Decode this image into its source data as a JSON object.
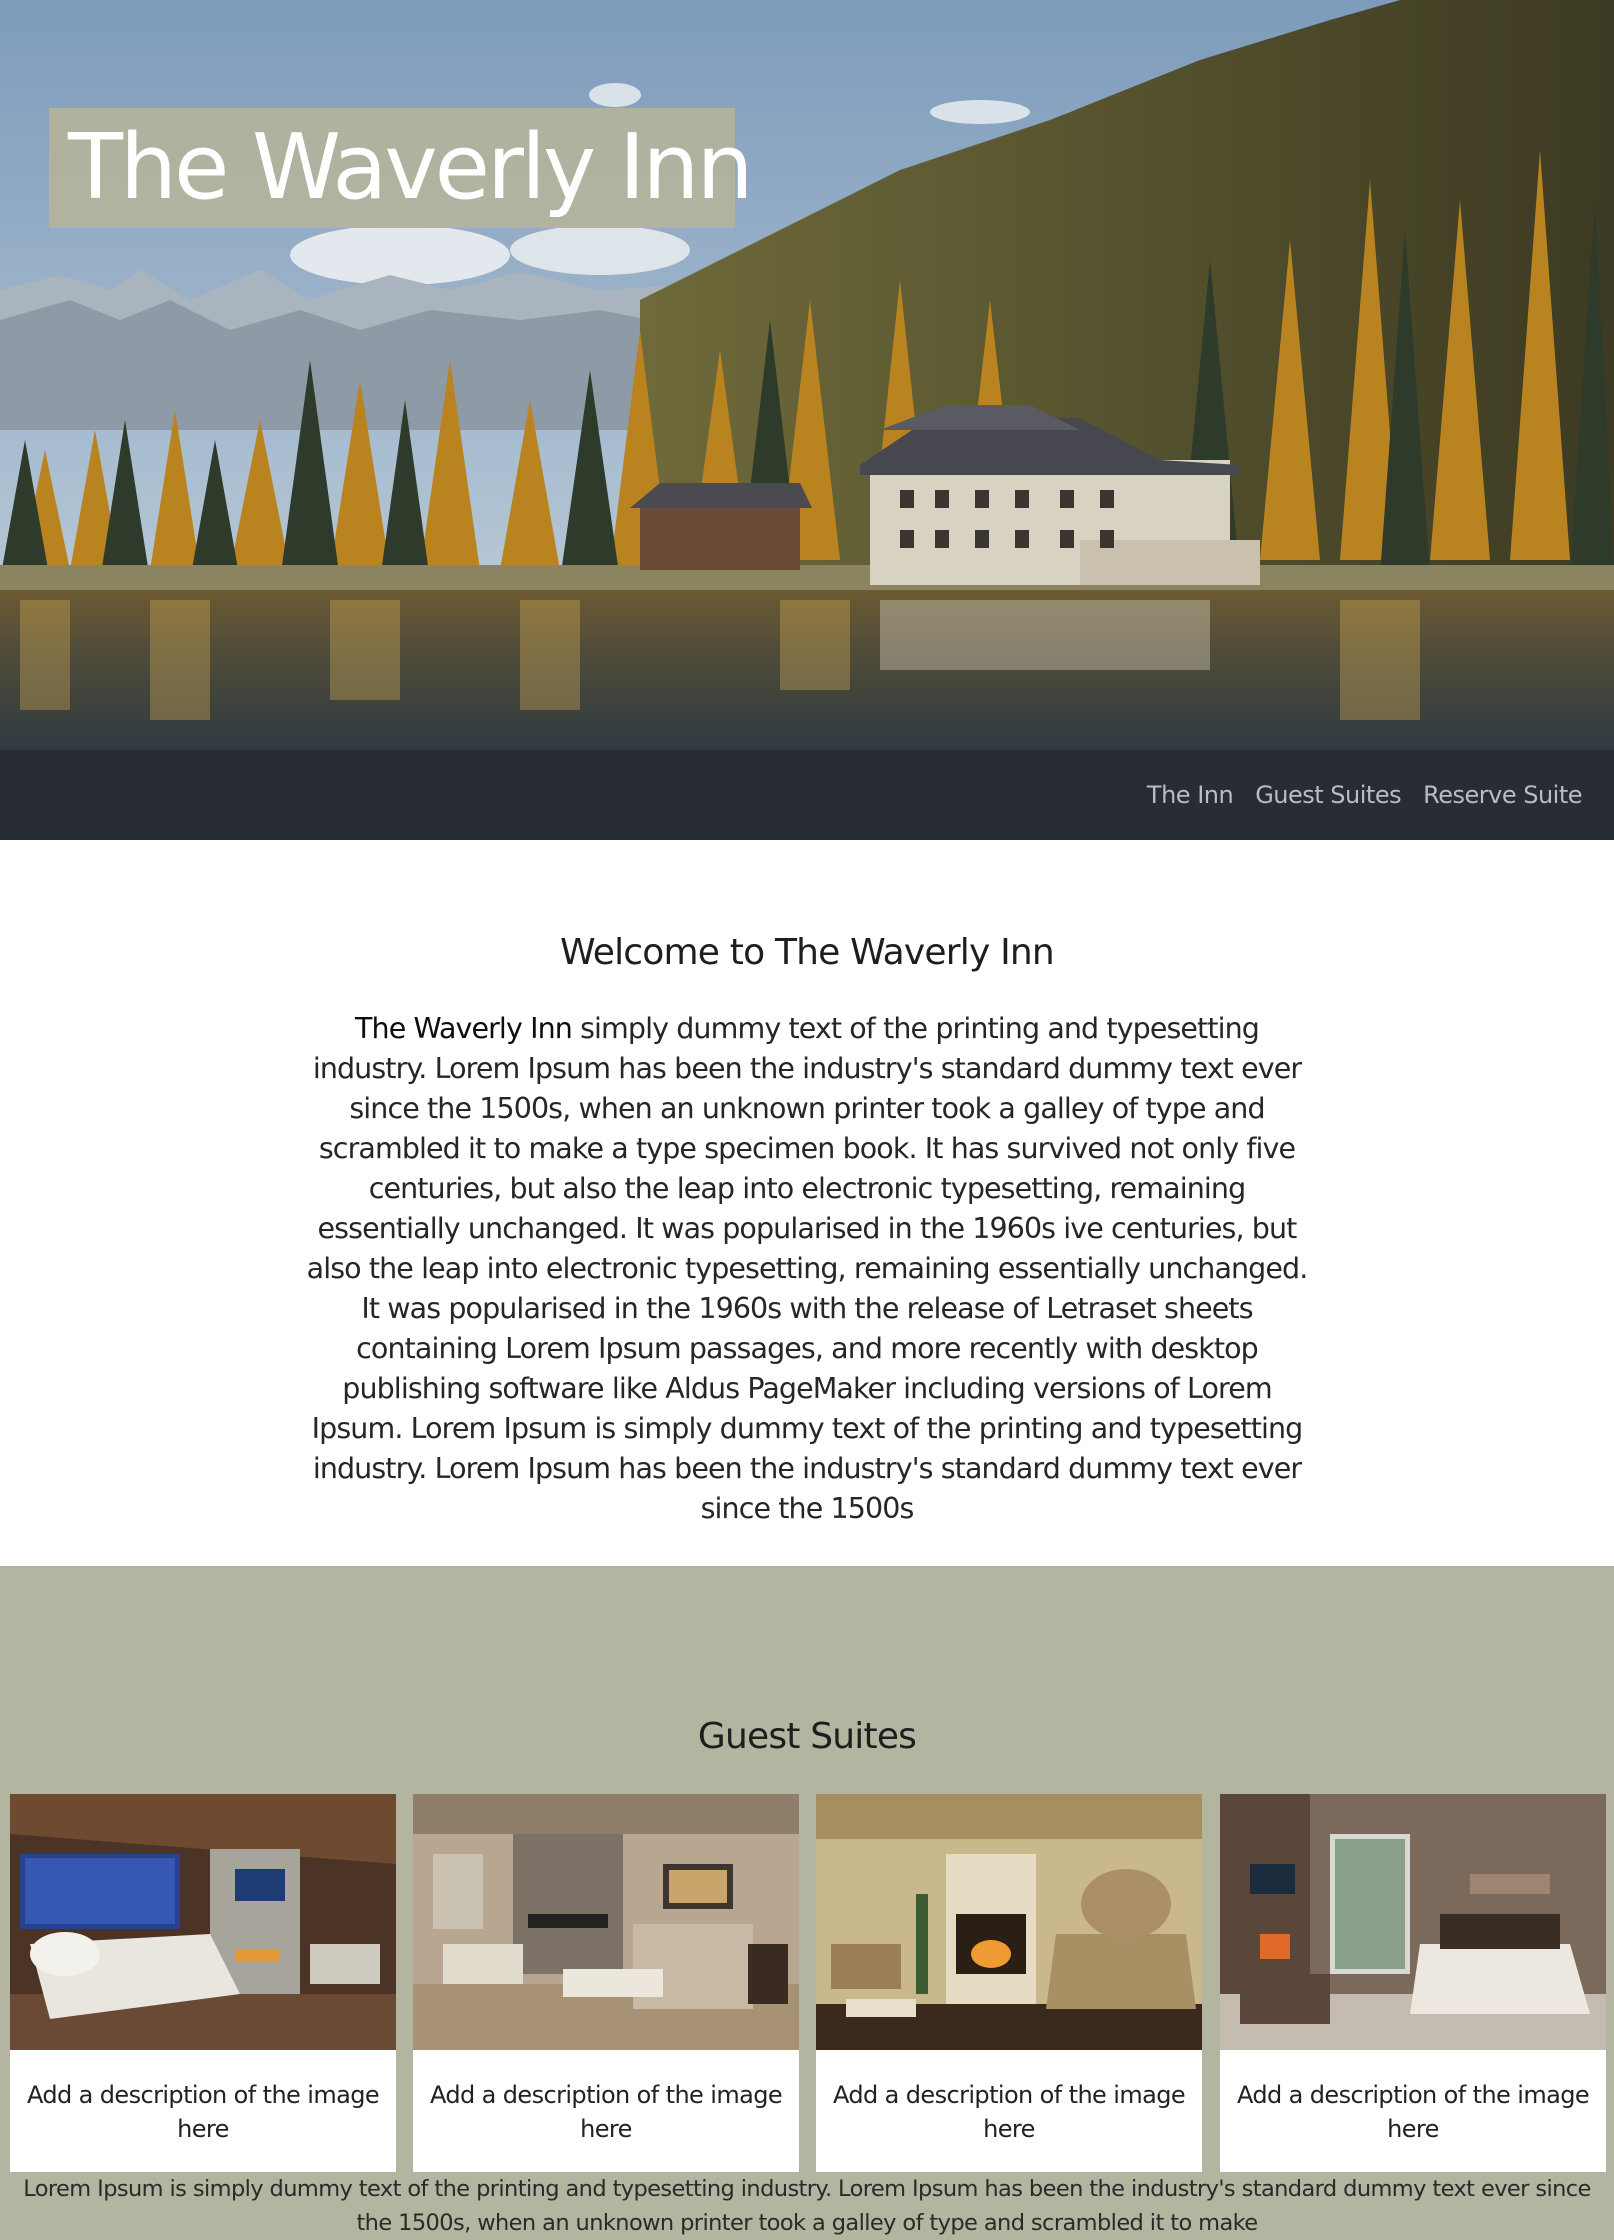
{
  "hero": {
    "title": "The Waverly Inn",
    "image": "hero-lake-inn-autumn-forest"
  },
  "nav": {
    "links": [
      "The Inn",
      "Guest Suites",
      "Reserve Suite"
    ]
  },
  "welcome": {
    "heading": "Welcome to The Waverly Inn",
    "lead": "The Waverly Inn",
    "body": " simply dummy text of the printing and typesetting industry. Lorem Ipsum has been the industry's standard dummy text ever since the 1500s, when an unknown printer took a galley of type and scrambled it to make a type specimen book. It has survived not only five centuries, but also the leap into electronic typesetting, remaining essentially unchanged. It was popularised in the 1960s ive centuries, but also the leap into electronic typesetting, remaining essentially unchanged. It was popularised in the 1960s with the release of Letraset sheets containing Lorem Ipsum passages, and more recently with desktop publishing software like Aldus PageMaker including versions of Lorem Ipsum. Lorem Ipsum is simply dummy text of the printing and typesetting industry. Lorem Ipsum has been the industry's standard dummy text ever since the 1500s"
  },
  "suites": {
    "heading": "Guest Suites",
    "cards": [
      {
        "caption": "Add a description of the image here"
      },
      {
        "caption": "Add a description of the image here"
      },
      {
        "caption": "Add a description of the image here"
      },
      {
        "caption": "Add a description of the image here"
      }
    ],
    "footer": "Lorem Ipsum is simply dummy text of the printing and typesetting industry. Lorem Ipsum has been the industry's standard dummy text ever since the 1500s, when an unknown printer took a galley of type and scrambled it to make"
  },
  "colors": {
    "nav_bg": "#282c33",
    "accent_sage": "#b4b5a0",
    "title_box": "#b2b39e"
  }
}
